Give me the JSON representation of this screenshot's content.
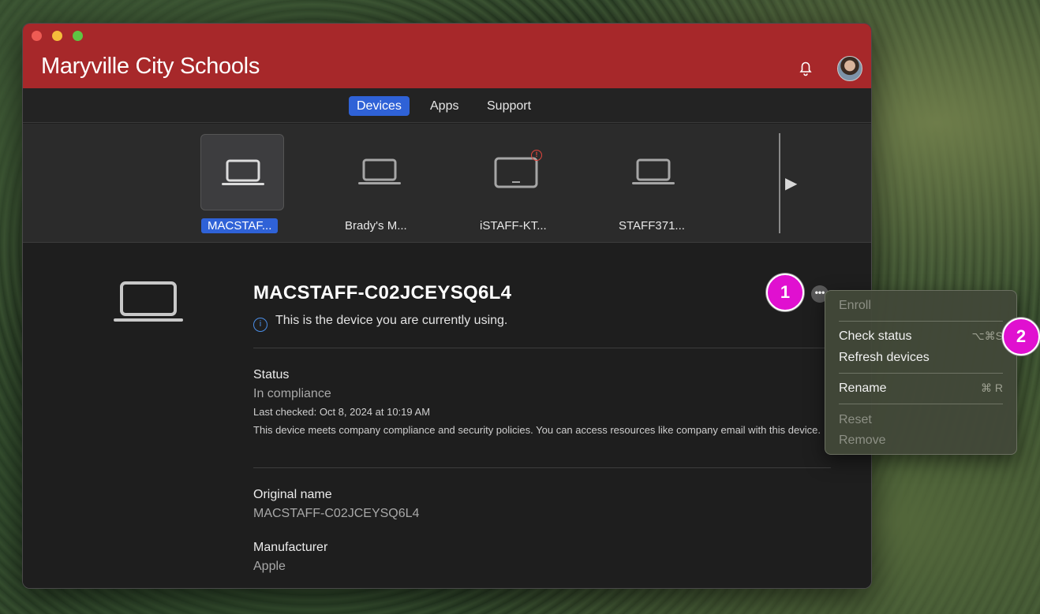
{
  "window": {
    "title": "Maryville City Schools"
  },
  "tabs": [
    {
      "label": "Devices",
      "active": true
    },
    {
      "label": "Apps",
      "active": false
    },
    {
      "label": "Support",
      "active": false
    }
  ],
  "devices": [
    {
      "label": "MACSTAF...",
      "type": "laptop",
      "selected": true
    },
    {
      "label": "Brady's M...",
      "type": "laptop",
      "selected": false
    },
    {
      "label": "iSTAFF-KT...",
      "type": "tablet",
      "selected": false,
      "alert": "!"
    },
    {
      "label": "STAFF371...",
      "type": "laptop",
      "selected": false
    }
  ],
  "carousel": {
    "next_icon": "play-triangle-icon",
    "next_glyph": "▶"
  },
  "detail": {
    "device_name": "MACSTAFF-C02JCEYSQ6L4",
    "current_device_note": "This is the device you are currently using.",
    "info_glyph": "i",
    "status_label": "Status",
    "status_value": "In compliance",
    "last_checked": "Last checked: Oct 8, 2024 at 10:19 AM",
    "status_description": "This device meets company compliance and security policies. You can access resources like company email with this device.",
    "original_name_label": "Original name",
    "original_name_value": "MACSTAFF-C02JCEYSQ6L4",
    "manufacturer_label": "Manufacturer",
    "manufacturer_value": "Apple",
    "more_glyph": "•••"
  },
  "menu": {
    "items": [
      {
        "label": "Enroll",
        "enabled": false,
        "shortcut": ""
      },
      {
        "label": "Check status",
        "enabled": true,
        "shortcut": "⌥⌘S"
      },
      {
        "label": "Refresh devices",
        "enabled": true,
        "shortcut": ""
      },
      {
        "label": "Rename",
        "enabled": true,
        "shortcut": "⌘ R"
      },
      {
        "label": "Reset",
        "enabled": false,
        "shortcut": ""
      },
      {
        "label": "Remove",
        "enabled": false,
        "shortcut": ""
      }
    ]
  },
  "annotations": [
    {
      "label": "1"
    },
    {
      "label": "2"
    }
  ],
  "colors": {
    "titlebar": "#a7282a",
    "accent": "#2f62d7",
    "badge": "#e010d0"
  }
}
